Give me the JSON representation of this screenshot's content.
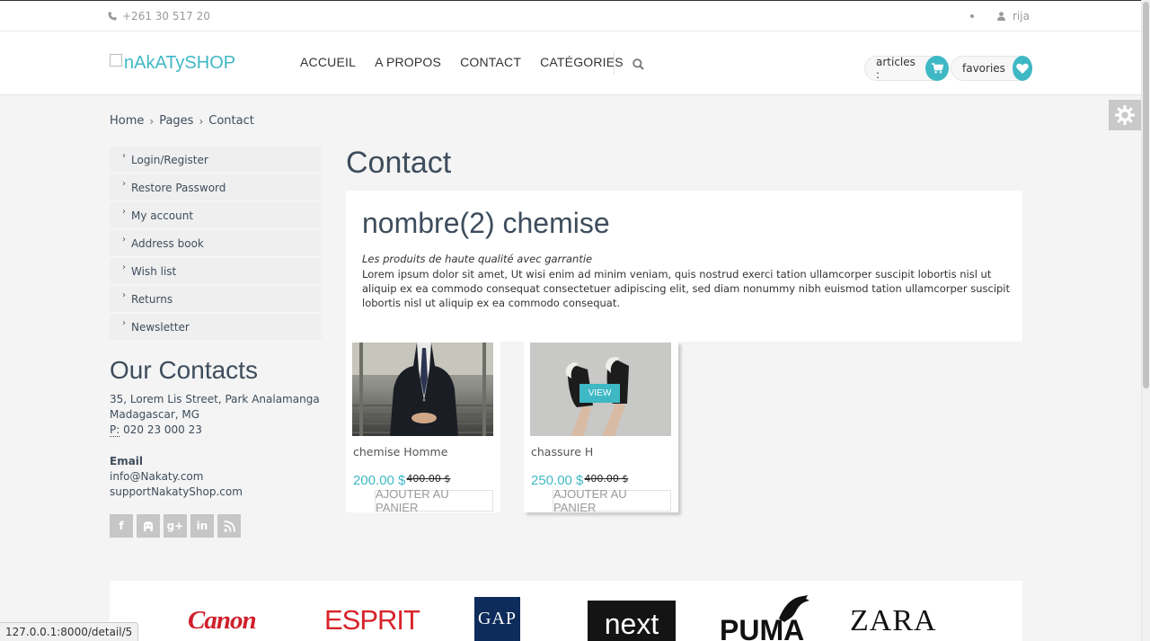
{
  "topbar": {
    "phone": "+261 30 517 20",
    "user": "rija"
  },
  "header": {
    "logo_alt": "nAkATySHOP",
    "nav": [
      "ACCUEIL",
      "A PROPOS",
      "CONTACT",
      "CATÉGORIES"
    ],
    "cart_label": "articles :",
    "fav_label": "favories"
  },
  "breadcrumb": [
    "Home",
    "Pages",
    "Contact"
  ],
  "sidebar": {
    "items": [
      "Login/Register",
      "Restore Password",
      "My account",
      "Address book",
      "Wish list",
      "Returns",
      "Newsletter"
    ]
  },
  "contacts": {
    "title": "Our Contacts",
    "address_line1": "35, Lorem Lis Street, Park Analamanga",
    "address_line2": "Madagascar, MG",
    "phone_prefix": "P:",
    "phone": "020 23 000 23",
    "email_label": "Email",
    "email1": "info@Nakaty.com",
    "email2": "supportNakatyShop.com"
  },
  "main": {
    "title": "Contact",
    "panel_heading": "nombre(2) chemise",
    "tagline": "Les produits de haute qualité avec garrantie",
    "description": "Lorem ipsum dolor sit amet, Ut wisi enim ad minim veniam, quis nostrud exerci tation ullamcorper suscipit lobortis nisl ut aliquip ex ea commodo consequat consectetuer adipiscing elit, sed diam nonummy nibh euismod tation ullamcorper suscipit lobortis nisl ut aliquip ex ea commodo consequat."
  },
  "products": [
    {
      "name": "chemise Homme",
      "price": "200.00 $",
      "old_price": "400.00 $",
      "button": "AJOUTER AU PANIER"
    },
    {
      "name": "chassure H",
      "price": "250.00 $",
      "old_price": "400.00 $",
      "button": "AJOUTER AU PANIER",
      "badge": "VIEW"
    }
  ],
  "brands": [
    "Canon",
    "ESPRIT",
    "GAP",
    "next",
    "PUMA",
    "ZARA"
  ],
  "statusbar": "127.0.0.1:8000/detail/5",
  "colors": {
    "accent": "#3fb8c5",
    "text": "#3e4d5c"
  }
}
